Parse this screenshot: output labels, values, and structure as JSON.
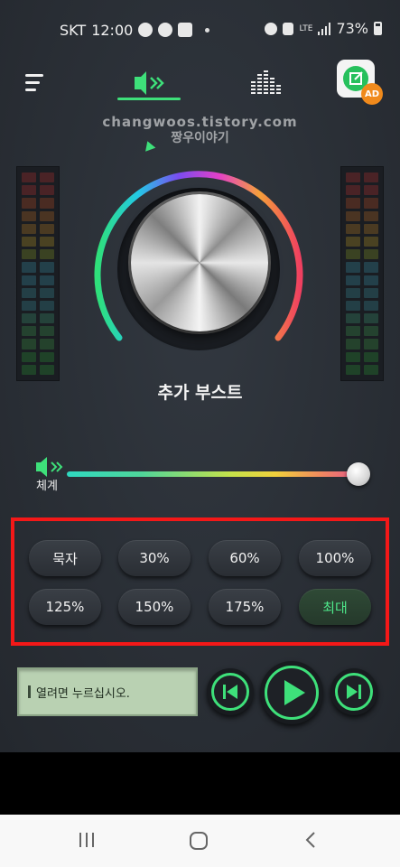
{
  "status_bar": {
    "carrier": "SKT",
    "time": "12:00",
    "network": "LTE",
    "battery": "73%"
  },
  "toolbar": {
    "menu_icon": "hamburger-menu-icon",
    "tabs": [
      {
        "name": "speaker-boost-tab",
        "icon": "speaker-icon",
        "active": true
      },
      {
        "name": "equalizer-tab",
        "icon": "equalizer-icon",
        "active": false
      }
    ],
    "ad_badge": "AD"
  },
  "watermark": {
    "line1": "changwoos.tistory.com",
    "line2": "짱우이야기"
  },
  "knob": {
    "label": "추가 부스트"
  },
  "volume": {
    "label": "체계",
    "level": 0.98
  },
  "presets": [
    {
      "label": "묵자",
      "active": false
    },
    {
      "label": "30%",
      "active": false
    },
    {
      "label": "60%",
      "active": false
    },
    {
      "label": "100%",
      "active": false
    },
    {
      "label": "125%",
      "active": false
    },
    {
      "label": "150%",
      "active": false
    },
    {
      "label": "175%",
      "active": false
    },
    {
      "label": "최대",
      "active": true
    }
  ],
  "player": {
    "track_text": "열려면 누르십시오.",
    "controls": [
      "previous-icon",
      "play-icon",
      "next-icon"
    ]
  },
  "colors": {
    "accent_green": "#3ee07a",
    "highlight_box": "#f41818",
    "background": "#2a2f36"
  }
}
